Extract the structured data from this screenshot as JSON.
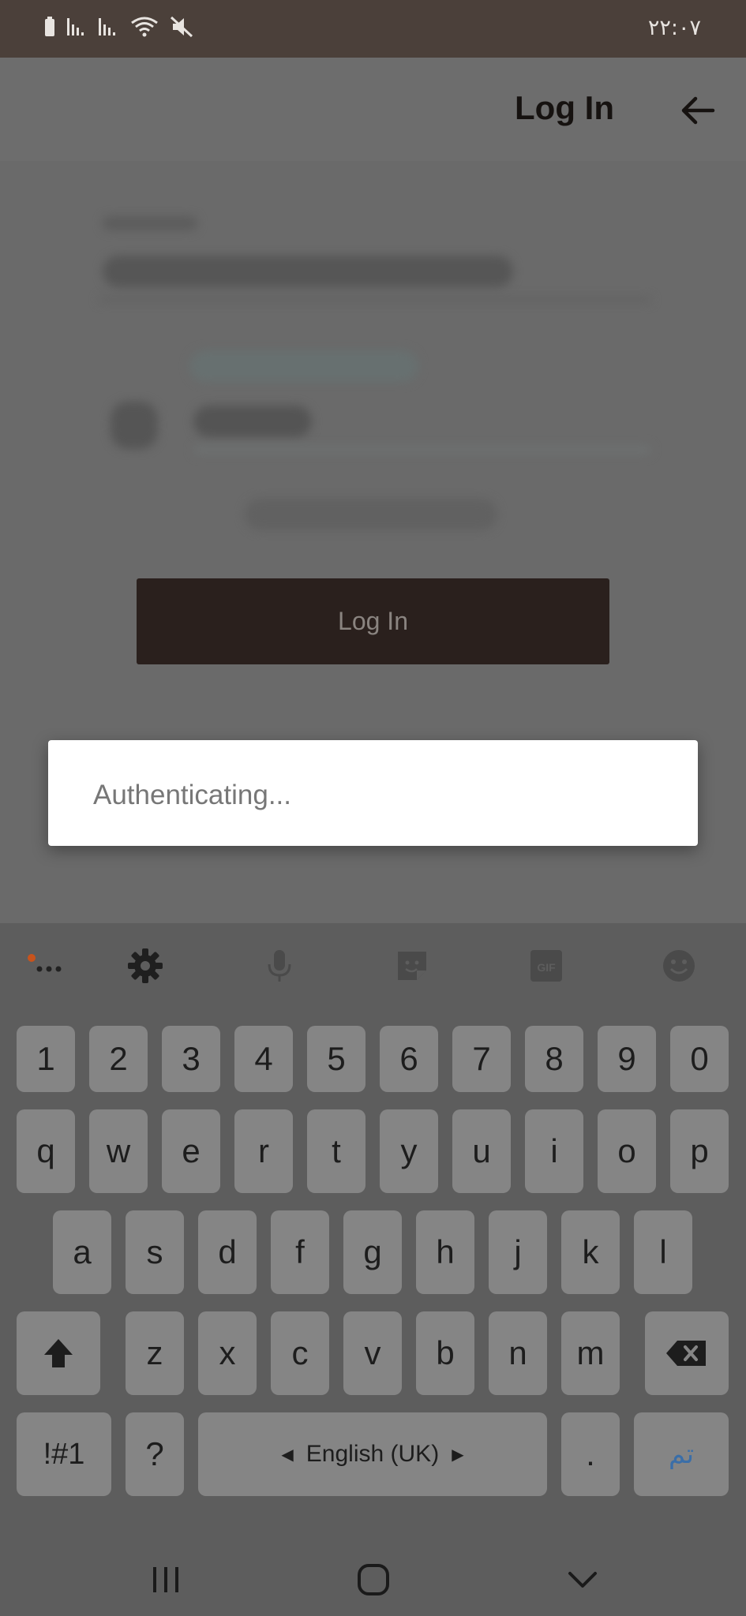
{
  "status_bar": {
    "time": "۲۲:۰۷",
    "icons": [
      "battery-icon",
      "signal-icon",
      "signal-icon",
      "wifi-icon",
      "mute-icon"
    ]
  },
  "header": {
    "title": "Log In",
    "back_icon": "arrow-back-icon"
  },
  "form": {
    "login_button_label": "Log In"
  },
  "dialog": {
    "message": "Authenticating..."
  },
  "keyboard": {
    "toolbar": [
      "more-icon",
      "gear-icon",
      "microphone-icon",
      "sticker-icon",
      "gif-icon",
      "emoji-icon"
    ],
    "number_row": [
      "1",
      "2",
      "3",
      "4",
      "5",
      "6",
      "7",
      "8",
      "9",
      "0"
    ],
    "row1": [
      "q",
      "w",
      "e",
      "r",
      "t",
      "y",
      "u",
      "i",
      "o",
      "p"
    ],
    "row2": [
      "a",
      "s",
      "d",
      "f",
      "g",
      "h",
      "j",
      "k",
      "l"
    ],
    "row3": [
      "z",
      "x",
      "c",
      "v",
      "b",
      "n",
      "m"
    ],
    "symbols_key": "!#1",
    "question_key": "?",
    "space_label": "English (UK)",
    "period_key": ".",
    "enter_key": "تم"
  },
  "navigation": [
    "recent-apps-icon",
    "home-icon",
    "back-chevron-icon"
  ],
  "colors": {
    "status_bar": "#4b403a",
    "button_bg": "#2a201d",
    "dialog_bg": "#ffffff"
  }
}
